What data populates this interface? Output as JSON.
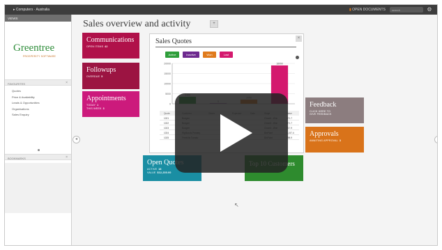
{
  "topbar": {
    "breadcrumb": "▸ Computers · Australia",
    "open_documents_label": "OPEN DOCUMENTS",
    "search_placeholder": "search"
  },
  "sidebar": {
    "views_label": "VIEWS",
    "logo_text": "Greentree",
    "logo_subtext": "PROSPERITY SOFTWARE",
    "favourites_label": "FAVOURITES",
    "favourites": [
      "Quotes",
      "Price & Availability",
      "Leads & Opportunities",
      "Organisations",
      "Sales Enquiry"
    ],
    "bookmarks_label": "BOOKMARKS"
  },
  "main": {
    "title": "Sales overview and activity"
  },
  "tiles": {
    "communications": {
      "title": "Communications",
      "sub_label": "OPEN ITEMS",
      "sub_value": "42",
      "color": "#b0114a"
    },
    "followups": {
      "title": "Followups",
      "sub_label": "OVERDUE",
      "sub_value": "5",
      "color": "#9c1442"
    },
    "appointments": {
      "title": "Appointments",
      "line1_label": "TODAY",
      "line1_value": "1",
      "line2_label": "THIS WEEK",
      "line2_value": "3",
      "color": "#cc1a7c"
    },
    "open_quotes": {
      "title": "Open Quotes",
      "line1_label": "ACTIVE",
      "line1_value": "18",
      "line2_label": "VALUE",
      "line2_value": "$12,230.00",
      "color": "#1a8ea3"
    },
    "top10": {
      "title": "Top 10 Customers",
      "color": "#2e8b2e"
    },
    "feedback": {
      "title": "Feedback",
      "line1": "CLICK HERE TO",
      "line2": "GIVE FEEDBACK",
      "color": "#8c7d7f"
    },
    "approvals": {
      "title": "Approvals",
      "sub_label": "AWAITING APPROVAL",
      "sub_value": "3",
      "color": "#d9731a"
    }
  },
  "sales_quotes": {
    "title": "Sales Quotes",
    "filters": [
      {
        "label": "Active",
        "color": "#2e9e3a"
      },
      {
        "label": "Inactive",
        "color": "#6e2a8f"
      },
      {
        "label": "Won",
        "color": "#e07b1c"
      },
      {
        "label": "Lost",
        "color": "#d4196e"
      }
    ],
    "columns": [
      "Quote",
      "Customer",
      "Status",
      "Expected",
      "Date",
      "Stage",
      "Value"
    ],
    "rows": [
      {
        "quote": "1021",
        "customer": "Bungee",
        "stage": "Closed - Won",
        "value": "471.7"
      },
      {
        "quote": "1022",
        "customer": "Bungee",
        "stage": "Closed - Won",
        "value": "471.7"
      },
      {
        "quote": "1023",
        "customer": "Bungee",
        "stage": "Closed - Won",
        "value": "717.9"
      },
      {
        "quote": "1024",
        "customer": "Highlands Primary",
        "stage": "BinPoint",
        "value": "1,247.4"
      },
      {
        "quote": "1025",
        "customer": "Freehills Tomato",
        "stage": "BinPoint",
        "value": "298.9"
      }
    ]
  },
  "chart_data": {
    "type": "bar",
    "categories": [
      "Active",
      "Inactive",
      "Won",
      "Lost"
    ],
    "values": [
      3480,
      0,
      2050,
      18990
    ],
    "ylim": [
      0,
      20000
    ],
    "yticks": [
      "20000",
      "15000",
      "10000",
      "5000",
      "0"
    ],
    "colors": [
      "#2e9e3a",
      "#6e2a8f",
      "#e07b1c",
      "#d4196e"
    ],
    "grid": true
  }
}
